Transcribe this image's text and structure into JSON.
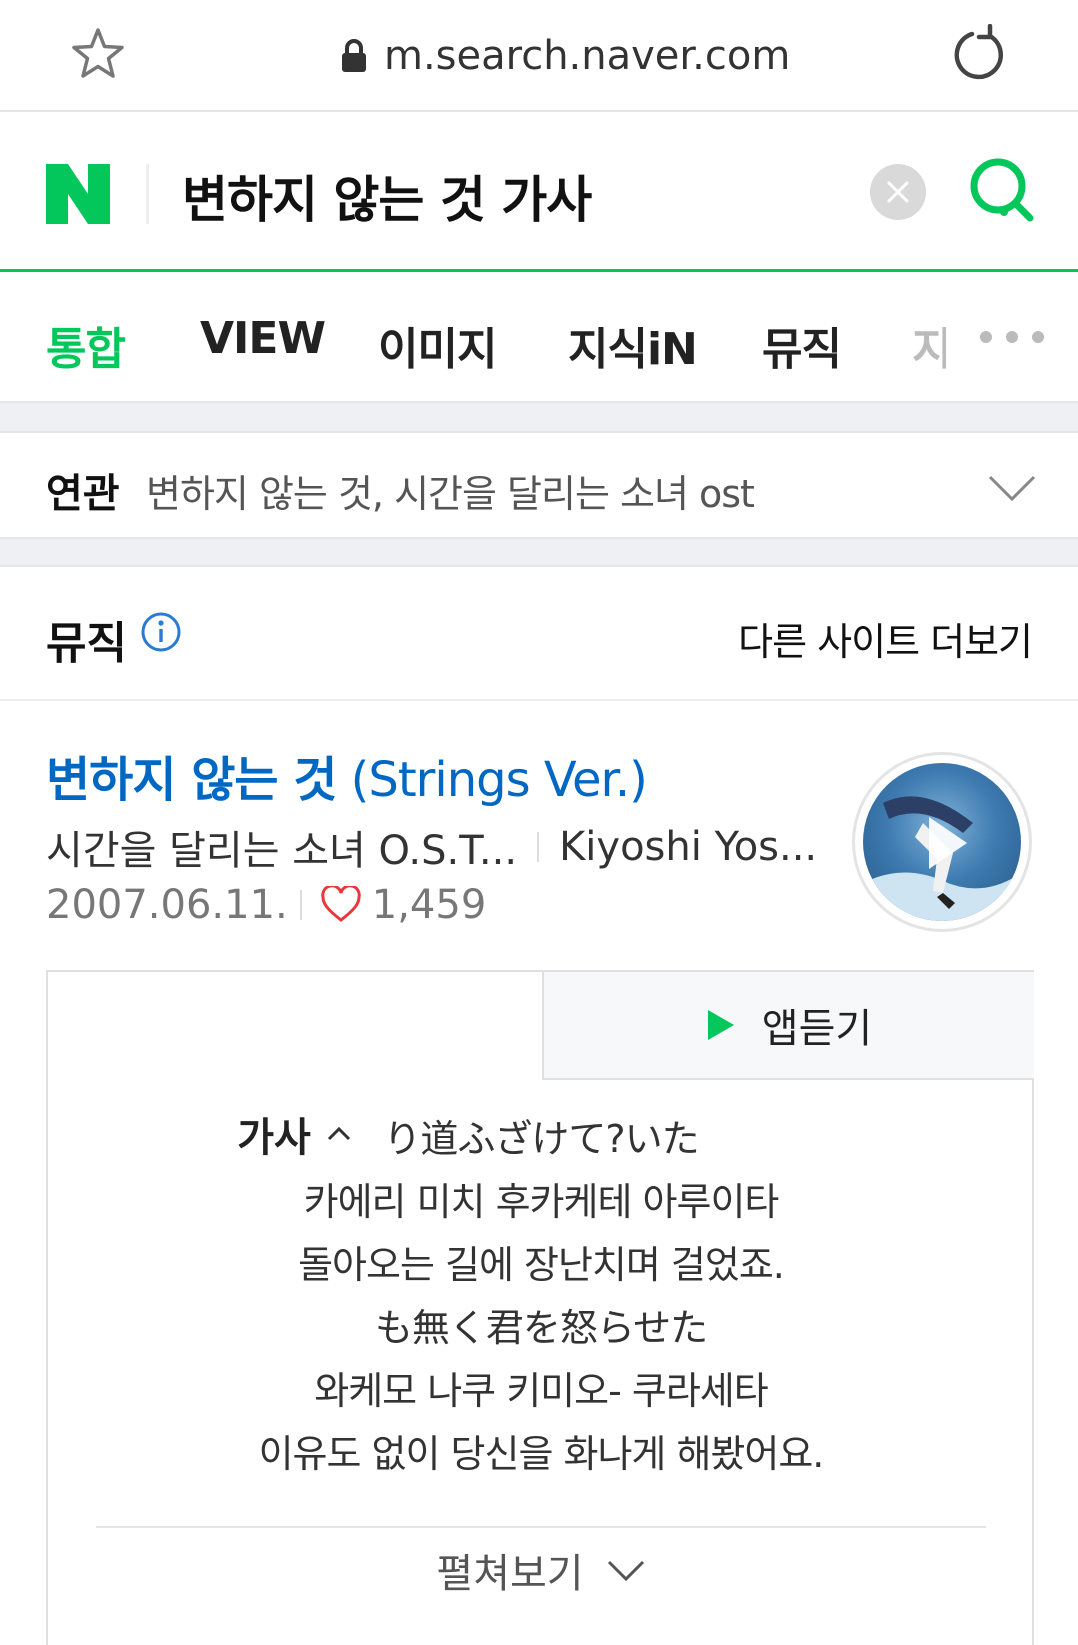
{
  "browser": {
    "url": "m.search.naver.com"
  },
  "search": {
    "query": "변하지 않는 것 가사",
    "brand_color": "#03c75a"
  },
  "tabs": [
    {
      "label": "통합",
      "active": true
    },
    {
      "label": "VIEW"
    },
    {
      "label": "이미지"
    },
    {
      "label": "지식iN"
    },
    {
      "label": "뮤직"
    },
    {
      "label": "지"
    }
  ],
  "related": {
    "label": "연관",
    "text": "변하지 않는 것, 시간을 달리는 소녀 ost"
  },
  "music": {
    "section_title": "뮤직",
    "more_sites": "다른 사이트 더보기",
    "song": {
      "title_bold": "변하지 않는 것",
      "title_rest": " (Strings Ver.)",
      "album": "시간을 달리는 소녀 O.S.T...",
      "artist": "Kiyoshi Yos...",
      "date": "2007.06.11.",
      "likes": "1,459"
    },
    "lyrics_tab": "가사",
    "listen_tab": "앱듣기",
    "lyrics": [
      "り道ふざけて?いた",
      "카에리 미치 후카케테 아루이타",
      "돌아오는 길에 장난치며 걸었죠.",
      "も無く君を怒らせた",
      "와케모 나쿠 키미오- 쿠라세타",
      "이유도 없이 당신을 화나게 해봤어요."
    ],
    "expand_label": "펼쳐보기"
  }
}
